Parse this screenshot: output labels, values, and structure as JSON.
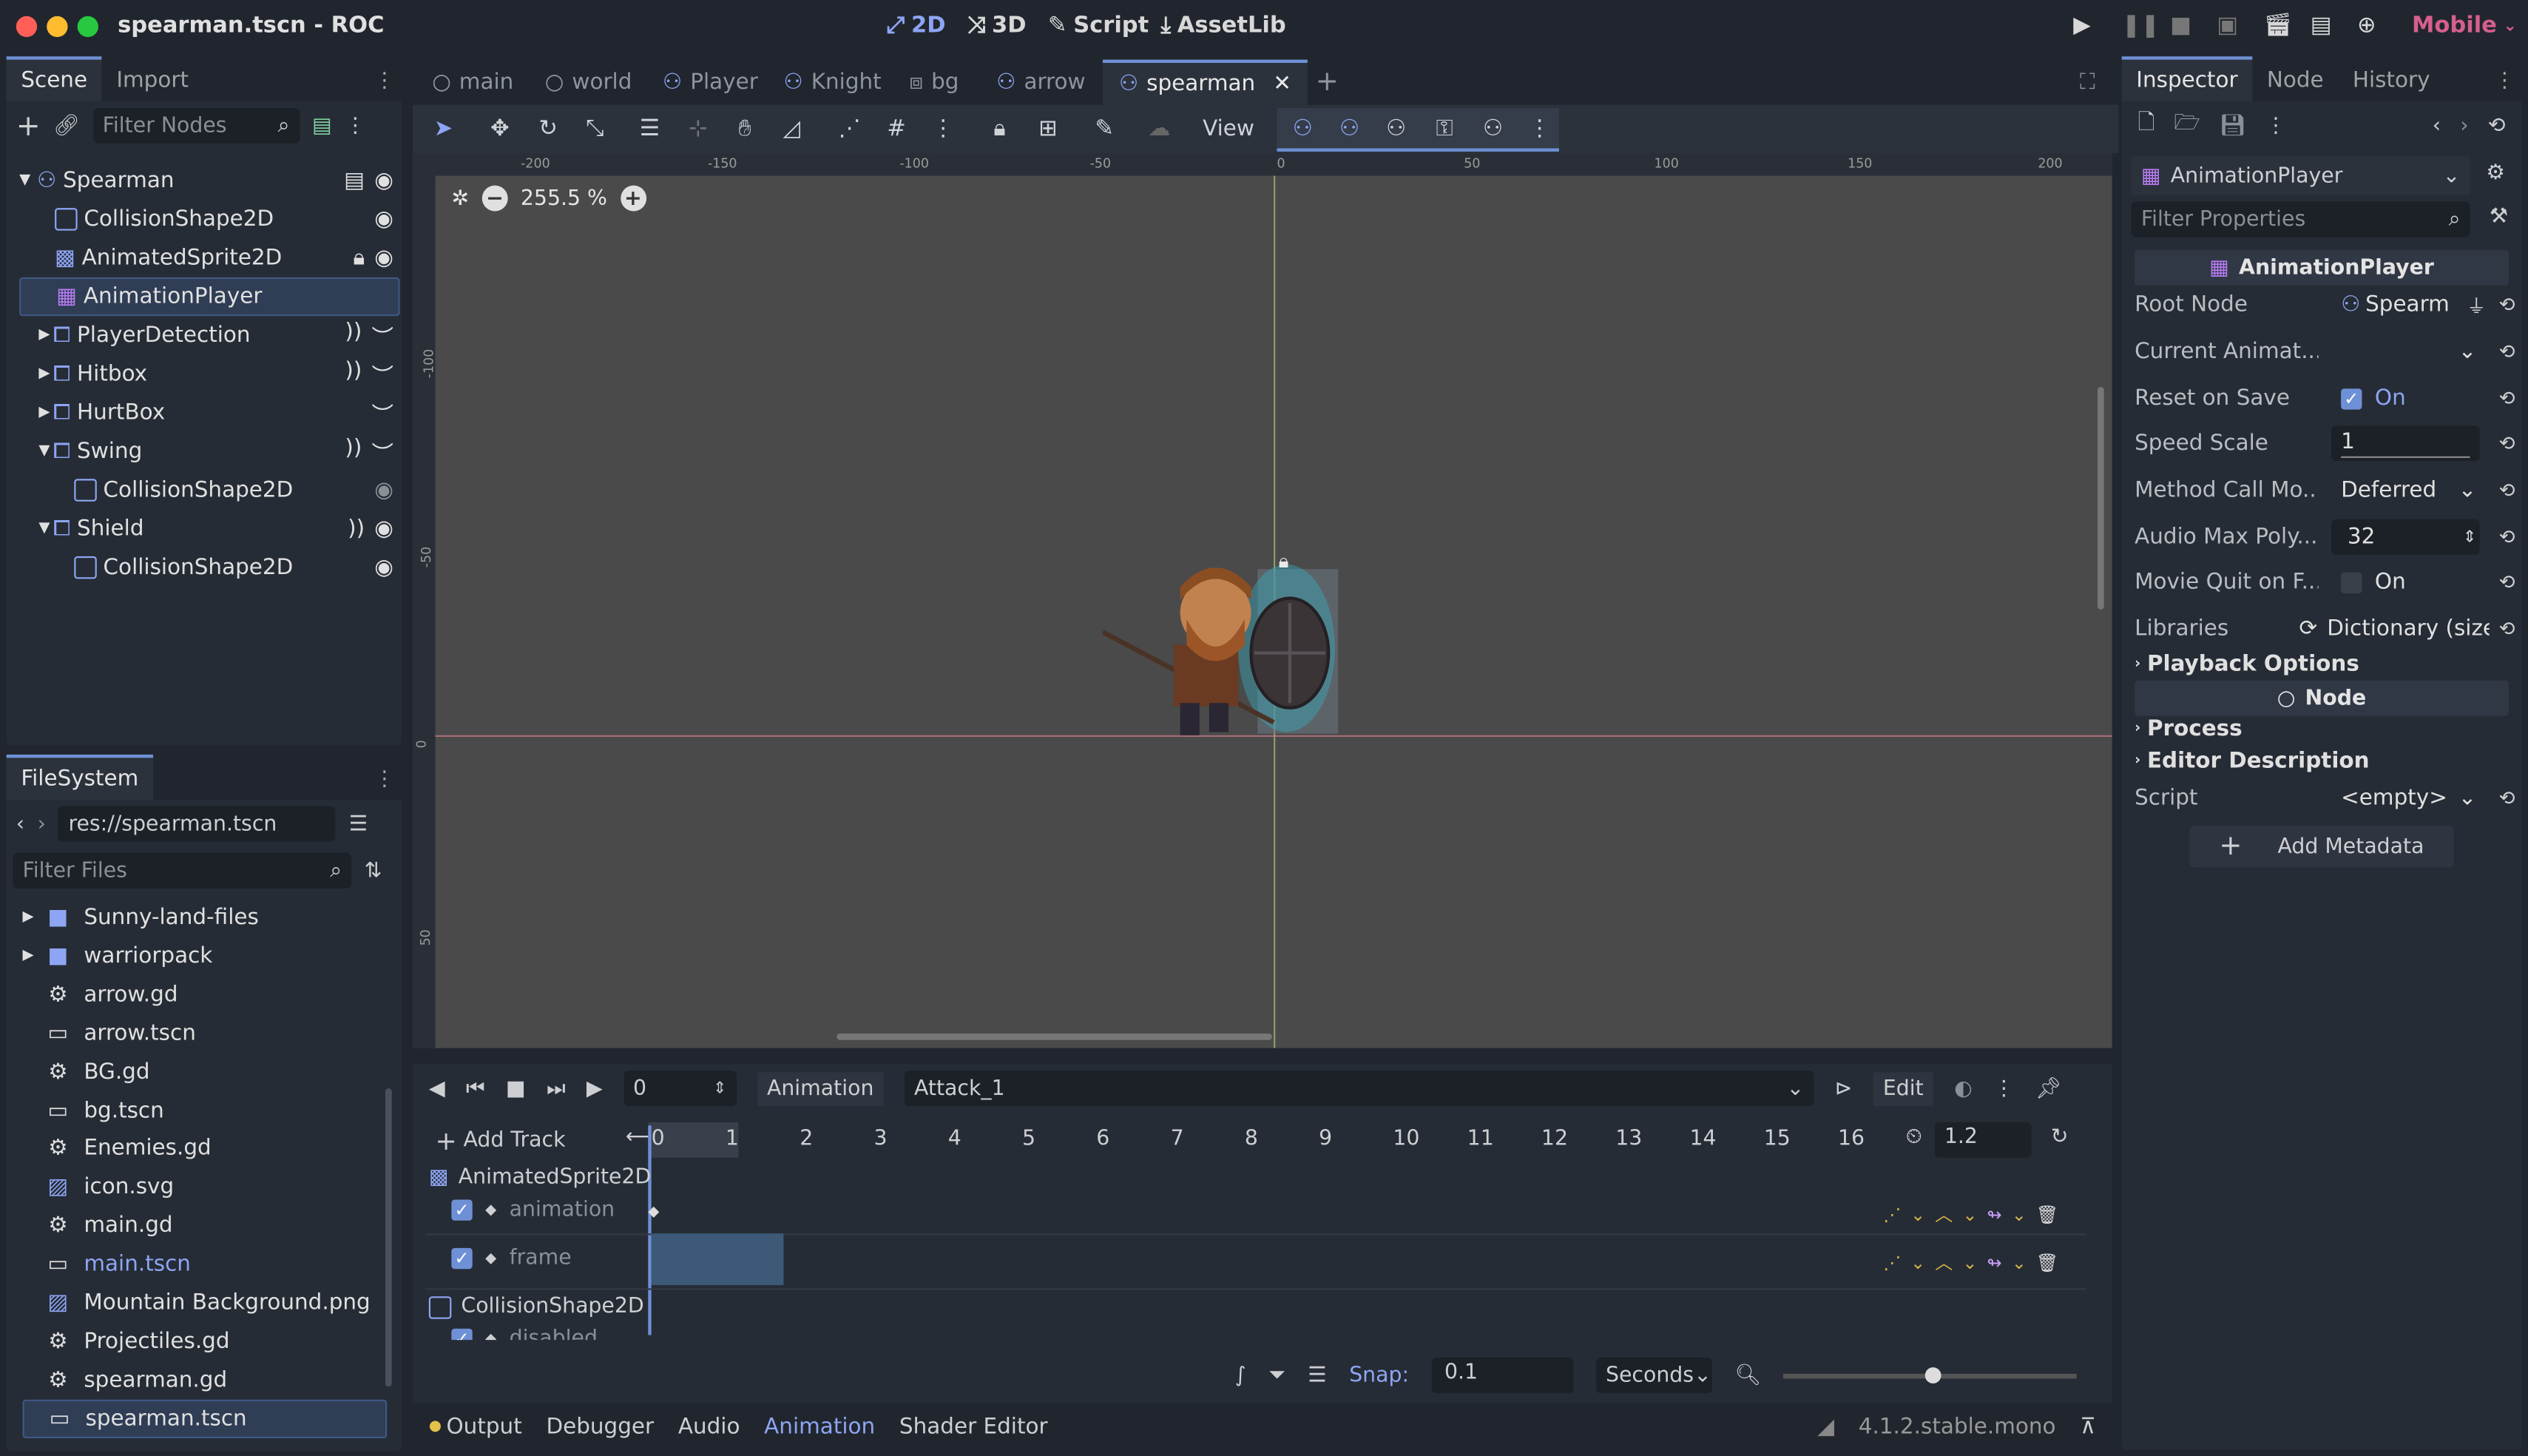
{
  "window": {
    "title": "spearman.tscn - ROC"
  },
  "topbar": {
    "mode2d": "2D",
    "mode3d": "3D",
    "script": "Script",
    "assetlib": "AssetLib",
    "renderer": "Mobile"
  },
  "scene_dock": {
    "tabs": [
      "Scene",
      "Import"
    ],
    "filter_placeholder": "Filter Nodes",
    "nodes": [
      {
        "label": "Spearman"
      },
      {
        "label": "CollisionShape2D"
      },
      {
        "label": "AnimatedSprite2D"
      },
      {
        "label": "AnimationPlayer"
      },
      {
        "label": "PlayerDetection"
      },
      {
        "label": "Hitbox"
      },
      {
        "label": "HurtBox"
      },
      {
        "label": "Swing"
      },
      {
        "label": "CollisionShape2D"
      },
      {
        "label": "Shield"
      },
      {
        "label": "CollisionShape2D"
      }
    ]
  },
  "filesystem": {
    "tab": "FileSystem",
    "path": "res://spearman.tscn",
    "filter_placeholder": "Filter Files",
    "items": [
      {
        "label": "Sunny-land-files",
        "icon": "folder-icon"
      },
      {
        "label": "warriorpack",
        "icon": "folder-icon"
      },
      {
        "label": "arrow.gd",
        "icon": "gear-icon"
      },
      {
        "label": "arrow.tscn",
        "icon": "clapper-icon"
      },
      {
        "label": "BG.gd",
        "icon": "gear-icon"
      },
      {
        "label": "bg.tscn",
        "icon": "clapper-icon"
      },
      {
        "label": "Enemies.gd",
        "icon": "gear-icon"
      },
      {
        "label": "icon.svg",
        "icon": "image-icon"
      },
      {
        "label": "main.gd",
        "icon": "gear-icon"
      },
      {
        "label": "main.tscn",
        "icon": "clapper-icon"
      },
      {
        "label": "Mountain Background.png",
        "icon": "image-icon"
      },
      {
        "label": "Projectiles.gd",
        "icon": "gear-icon"
      },
      {
        "label": "spearman.gd",
        "icon": "gear-icon"
      },
      {
        "label": "spearman.tscn",
        "icon": "clapper-icon"
      }
    ]
  },
  "editor_tabs": [
    "main",
    "world",
    "Player",
    "Knight",
    "bg",
    "arrow",
    "spearman"
  ],
  "toolbar": {
    "view": "View"
  },
  "viewport": {
    "zoom": "255.5 %",
    "ruler_x": [
      "-200",
      "-150",
      "-100",
      "-50",
      "0",
      "50",
      "100",
      "150",
      "200"
    ],
    "ruler_y": [
      "-100",
      "-50",
      "0",
      "50"
    ]
  },
  "animation": {
    "time": "0",
    "animation_label": "Animation",
    "current": "Attack_1",
    "edit": "Edit",
    "add_track": "Add Track",
    "timeline": [
      "0",
      "1",
      "2",
      "3",
      "4",
      "5",
      "6",
      "7",
      "8",
      "9",
      "10",
      "11",
      "12",
      "13",
      "14",
      "15",
      "16"
    ],
    "length": "1.2",
    "tracks": {
      "group1": "AnimatedSprite2D",
      "t1": "animation",
      "t2": "frame",
      "group2": "CollisionShape2D",
      "t3": "disabled"
    },
    "snap_label": "Snap:",
    "snap_value": "0.1",
    "snap_unit": "Seconds"
  },
  "bottom_tabs": {
    "output": "Output",
    "debugger": "Debugger",
    "audio": "Audio",
    "animation": "Animation",
    "shader": "Shader Editor",
    "version": "4.1.2.stable.mono"
  },
  "inspector": {
    "tabs": [
      "Inspector",
      "Node",
      "History"
    ],
    "object": "AnimationPlayer",
    "filter_placeholder": "Filter Properties",
    "header": "AnimationPlayer",
    "props": [
      {
        "label": "Root Node",
        "value": "Spearm"
      },
      {
        "label": "Current Animat...",
        "value": ""
      },
      {
        "label": "Reset on Save",
        "value": "On"
      },
      {
        "label": "Speed Scale",
        "value": "1"
      },
      {
        "label": "Method Call Mo...",
        "value": "Deferred"
      },
      {
        "label": "Audio Max Poly...",
        "value": "32"
      },
      {
        "label": "Movie Quit on F...",
        "value": "On"
      },
      {
        "label": "Libraries",
        "value": "Dictionary (size"
      }
    ],
    "playback": "Playback Options",
    "node_header": "Node",
    "process": "Process",
    "editor_desc": "Editor Description",
    "script_label": "Script",
    "script_value": "<empty>",
    "add_metadata": "Add Metadata"
  },
  "colors": {
    "accent": "#6e90d6",
    "node_blue": "#8da5f3",
    "anim_purple": "#b57cf0",
    "renderer": "#d55f8d"
  }
}
